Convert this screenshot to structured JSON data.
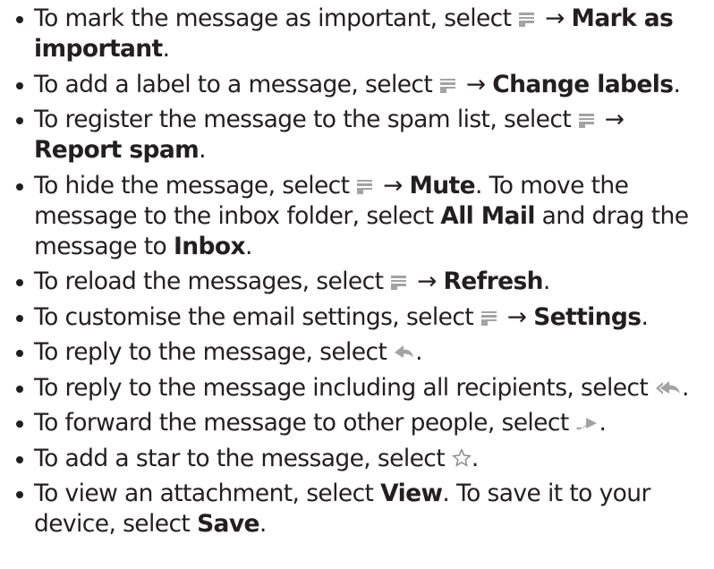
{
  "icons": {
    "menu": "menu-icon",
    "reply": "reply-icon",
    "reply_all": "reply-all-icon",
    "forward": "forward-icon",
    "star": "star-icon",
    "icon_color": "#a3a3a3",
    "text_color": "#231f20"
  },
  "arrow": "→",
  "items": [
    {
      "t1": "To mark the message as important, select ",
      "b1": "Mark as important",
      "t2": "."
    },
    {
      "t1": "To add a label to a message, select ",
      "b1": "Change labels",
      "t2": "."
    },
    {
      "t1": "To register the message to the spam list, select ",
      "b1": "Report spam",
      "t2": "."
    },
    {
      "t1": "To hide the message, select ",
      "b1": "Mute",
      "t2": ". To move the message to the inbox folder, select ",
      "b2": "All Mail",
      "t3": " and drag the message to ",
      "b3": "Inbox",
      "t4": "."
    },
    {
      "t1": "To reload the messages, select ",
      "b1": "Refresh",
      "t2": "."
    },
    {
      "t1": "To customise the email settings, select ",
      "b1": "Settings",
      "t2": "."
    },
    {
      "t1": "To reply to the message, select ",
      "t2": "."
    },
    {
      "t1": "To reply to the message including all recipients, select ",
      "t2": "."
    },
    {
      "t1": "To forward the message to other people, select ",
      "t2": "."
    },
    {
      "t1": "To add a star to the message, select ",
      "t2": "."
    },
    {
      "t1": "To view an attachment, select ",
      "b1": "View",
      "t2": ". To save it to your device, select ",
      "b2": "Save",
      "t3": "."
    }
  ]
}
